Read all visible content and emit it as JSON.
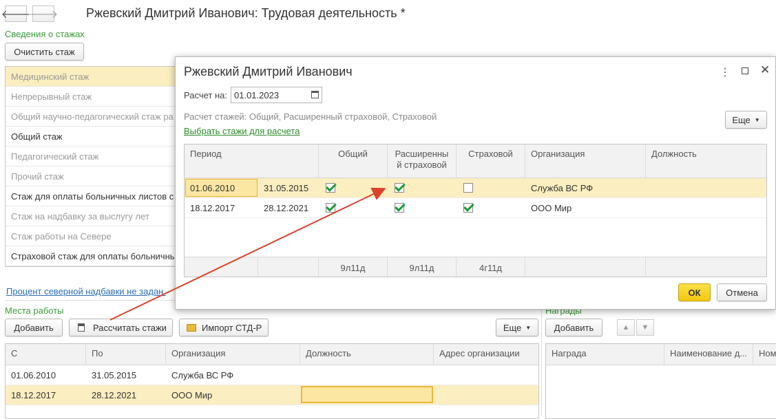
{
  "window": {
    "title": "Ржевский Дмитрий Иванович: Трудовая деятельность *",
    "back_glyph": "🡐",
    "forward_glyph": "🡒"
  },
  "stazh_section": {
    "label": "Сведения о стажах",
    "clear_button": "Очистить стаж",
    "items": [
      "Медицинский стаж",
      "Непрерывный стаж",
      "Общий научно-педагогический стаж ра",
      "Общий стаж",
      "Педагогический стаж",
      "Прочий стаж",
      "Стаж для оплаты больничных листов с",
      "Стаж на надбавку за выслугу лет",
      "Стаж работы на Севере",
      "Страховой стаж для оплаты больничных"
    ],
    "north_link": "Процент северной надбавки не задан."
  },
  "work_section": {
    "label": "Места работы",
    "add_button": "Добавить",
    "calc_button": "Рассчитать стажи",
    "import_button": "Импорт СТД-Р",
    "more_button": "Еще",
    "columns": [
      "С",
      "По",
      "Организация",
      "Должность",
      "Адрес организации"
    ],
    "rows": [
      [
        "01.06.2010",
        "31.05.2015",
        "Служба ВС РФ",
        "",
        ""
      ],
      [
        "18.12.2017",
        "28.12.2021",
        "ООО Мир",
        "",
        ""
      ]
    ]
  },
  "awards_section": {
    "label": "Награды",
    "add_button": "Добавить",
    "columns": [
      "Награда",
      "Наименование д...",
      "Ном"
    ]
  },
  "modal": {
    "title": "Ржевский Дмитрий Иванович",
    "calc_on_label": "Расчет на:",
    "calc_on_value": "01.01.2023",
    "calc_info": "Расчет стажей: Общий, Расширенный страховой, Страховой",
    "choose_link": "Выбрать стажи для расчета",
    "more_button": "Еще",
    "columns": [
      "Период",
      "Общий",
      "Расширенны й страховой",
      "Страховой",
      "Организация",
      "Должность"
    ],
    "rows": [
      {
        "from": "01.06.2010",
        "to": "31.05.2015",
        "general": true,
        "extended": true,
        "insurance": false,
        "org": "Служба ВС РФ",
        "position": ""
      },
      {
        "from": "18.12.2017",
        "to": "28.12.2021",
        "general": true,
        "extended": true,
        "insurance": true,
        "org": "ООО Мир",
        "position": ""
      }
    ],
    "totals": {
      "general": "9л11д",
      "extended": "9л11д",
      "insurance": "4г11д"
    },
    "ok_button": "ОК",
    "cancel_button": "Отмена"
  },
  "colors": {
    "accent_green": "#3a9a3a",
    "selection_yellow": "#fbeec0",
    "ok_yellow": "#f5d21f",
    "arrow_red": "#d9432b"
  }
}
